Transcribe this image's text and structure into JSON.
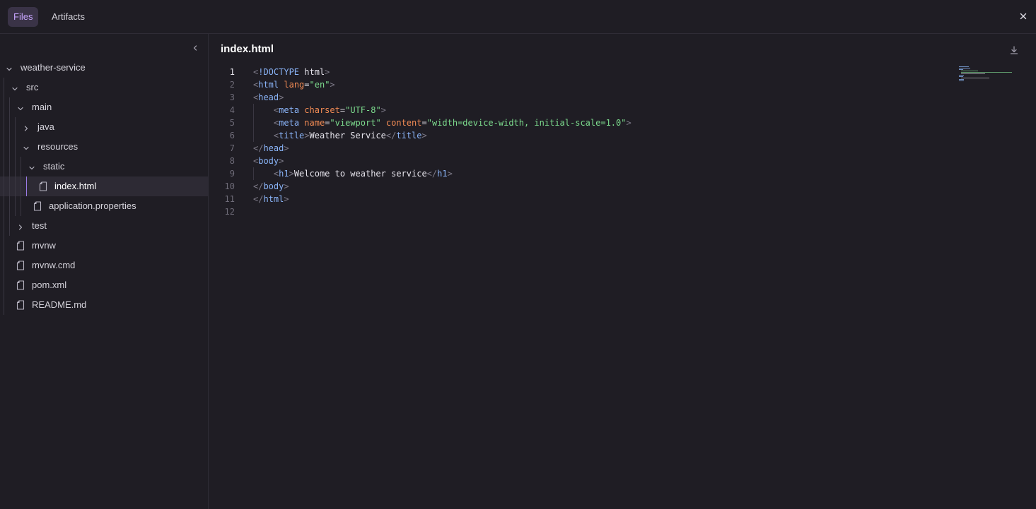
{
  "tabs": [
    {
      "label": "Files",
      "active": true
    },
    {
      "label": "Artifacts",
      "active": false
    }
  ],
  "close_icon": "close-icon",
  "sidebar": {
    "collapse_icon": "chevron-left-icon",
    "tree": [
      {
        "label": "weather-service",
        "type": "folder",
        "expanded": true,
        "depth": 0
      },
      {
        "label": "src",
        "type": "folder",
        "expanded": true,
        "depth": 1
      },
      {
        "label": "main",
        "type": "folder",
        "expanded": true,
        "depth": 2
      },
      {
        "label": "java",
        "type": "folder",
        "expanded": false,
        "depth": 3
      },
      {
        "label": "resources",
        "type": "folder",
        "expanded": true,
        "depth": 3
      },
      {
        "label": "static",
        "type": "folder",
        "expanded": true,
        "depth": 4
      },
      {
        "label": "index.html",
        "type": "file",
        "selected": true,
        "depth": 5
      },
      {
        "label": "application.properties",
        "type": "file",
        "depth": 4
      },
      {
        "label": "test",
        "type": "folder",
        "expanded": false,
        "depth": 2
      },
      {
        "label": "mvnw",
        "type": "file",
        "depth": 1
      },
      {
        "label": "mvnw.cmd",
        "type": "file",
        "depth": 1
      },
      {
        "label": "pom.xml",
        "type": "file",
        "depth": 1
      },
      {
        "label": "README.md",
        "type": "file",
        "depth": 1
      }
    ]
  },
  "editor": {
    "file_name": "index.html",
    "download_icon": "download-icon",
    "current_line": 1,
    "lines": [
      {
        "number": "1",
        "text": "<!DOCTYPE html>"
      },
      {
        "number": "2",
        "text": "<html lang=\"en\">"
      },
      {
        "number": "3",
        "text": "<head>"
      },
      {
        "number": "4",
        "text": "    <meta charset=\"UTF-8\">"
      },
      {
        "number": "5",
        "text": "    <meta name=\"viewport\" content=\"width=device-width, initial-scale=1.0\">"
      },
      {
        "number": "6",
        "text": "    <title>Weather Service</title>"
      },
      {
        "number": "7",
        "text": "</head>"
      },
      {
        "number": "8",
        "text": "<body>"
      },
      {
        "number": "9",
        "text": "    <h1>Welcome to weather service</h1>"
      },
      {
        "number": "10",
        "text": "</body>"
      },
      {
        "number": "11",
        "text": "</html>"
      },
      {
        "number": "12",
        "text": ""
      }
    ]
  },
  "colors": {
    "background": "#1f1d24",
    "accent": "#c8a6ff",
    "selection": "#2d2a34",
    "tag": "#8ab4f8",
    "attribute": "#f28b54",
    "string": "#7ddc8e"
  }
}
